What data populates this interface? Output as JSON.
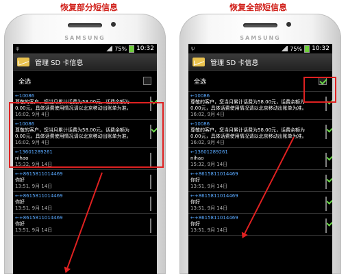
{
  "captions": {
    "left": "恢复部分短信息",
    "right": "恢复全部短信息"
  },
  "phones": [
    {
      "brand": "SAMSUNG",
      "status": {
        "usb": "ψ",
        "battery": "75%",
        "time": "10:32"
      },
      "app_title": "管理 SD 卡信息",
      "select_all": {
        "label": "全选",
        "checked": false
      },
      "messages": [
        {
          "sender": "←10086",
          "body": "尊敬的客户，您当月累计话费为58.00元，话费余额为0.00元，具体话费使用情况请以北京移动出账单为准。",
          "date": "16:02, 9月 4日",
          "checked": true
        },
        {
          "sender": "←10086",
          "body": "尊敬的客户，您当月累计话费为58.00元，话费余额为0.00元，具体话费使用情况请以北京移动出账单为准。",
          "date": "16:02, 9月 4日",
          "checked": true
        },
        {
          "sender": "←13601289261",
          "body": "nihao",
          "date": "15:32, 9月 14日",
          "checked": false
        },
        {
          "sender": "←+8615811014469",
          "body": "你好",
          "date": "13:51, 9月 14日",
          "checked": false
        },
        {
          "sender": "←+8615811014469",
          "body": "你好",
          "date": "13:51, 9月 14日",
          "checked": false
        },
        {
          "sender": "←+8615811014469",
          "body": "你好",
          "date": "13:51, 9月 14日",
          "checked": false
        }
      ]
    },
    {
      "brand": "SAMSUNG",
      "status": {
        "usb": "ψ",
        "battery": "75%",
        "time": "10:32"
      },
      "app_title": "管理 SD 卡信息",
      "select_all": {
        "label": "全选",
        "checked": true
      },
      "messages": [
        {
          "sender": "←10086",
          "body": "尊敬的客户，您当月累计话费为58.00元，话费余额为0.00元，具体话费使用情况请以北京移动出账单为准。",
          "date": "16:02, 9月 4日",
          "checked": true
        },
        {
          "sender": "←10086",
          "body": "尊敬的客户，您当月累计话费为58.00元，话费余额为0.00元，具体话费使用情况请以北京移动出账单为准。",
          "date": "16:02, 9月 4日",
          "checked": true
        },
        {
          "sender": "←13601289261",
          "body": "nihao",
          "date": "15:32, 9月 14日",
          "checked": true
        },
        {
          "sender": "←+8615811014469",
          "body": "你好",
          "date": "13:51, 9月 14日",
          "checked": true
        },
        {
          "sender": "←+8615811014469",
          "body": "你好",
          "date": "13:51, 9月 14日",
          "checked": true
        },
        {
          "sender": "←+8615811014469",
          "body": "你好",
          "date": "13:51, 9月 14日",
          "checked": true
        }
      ]
    }
  ]
}
